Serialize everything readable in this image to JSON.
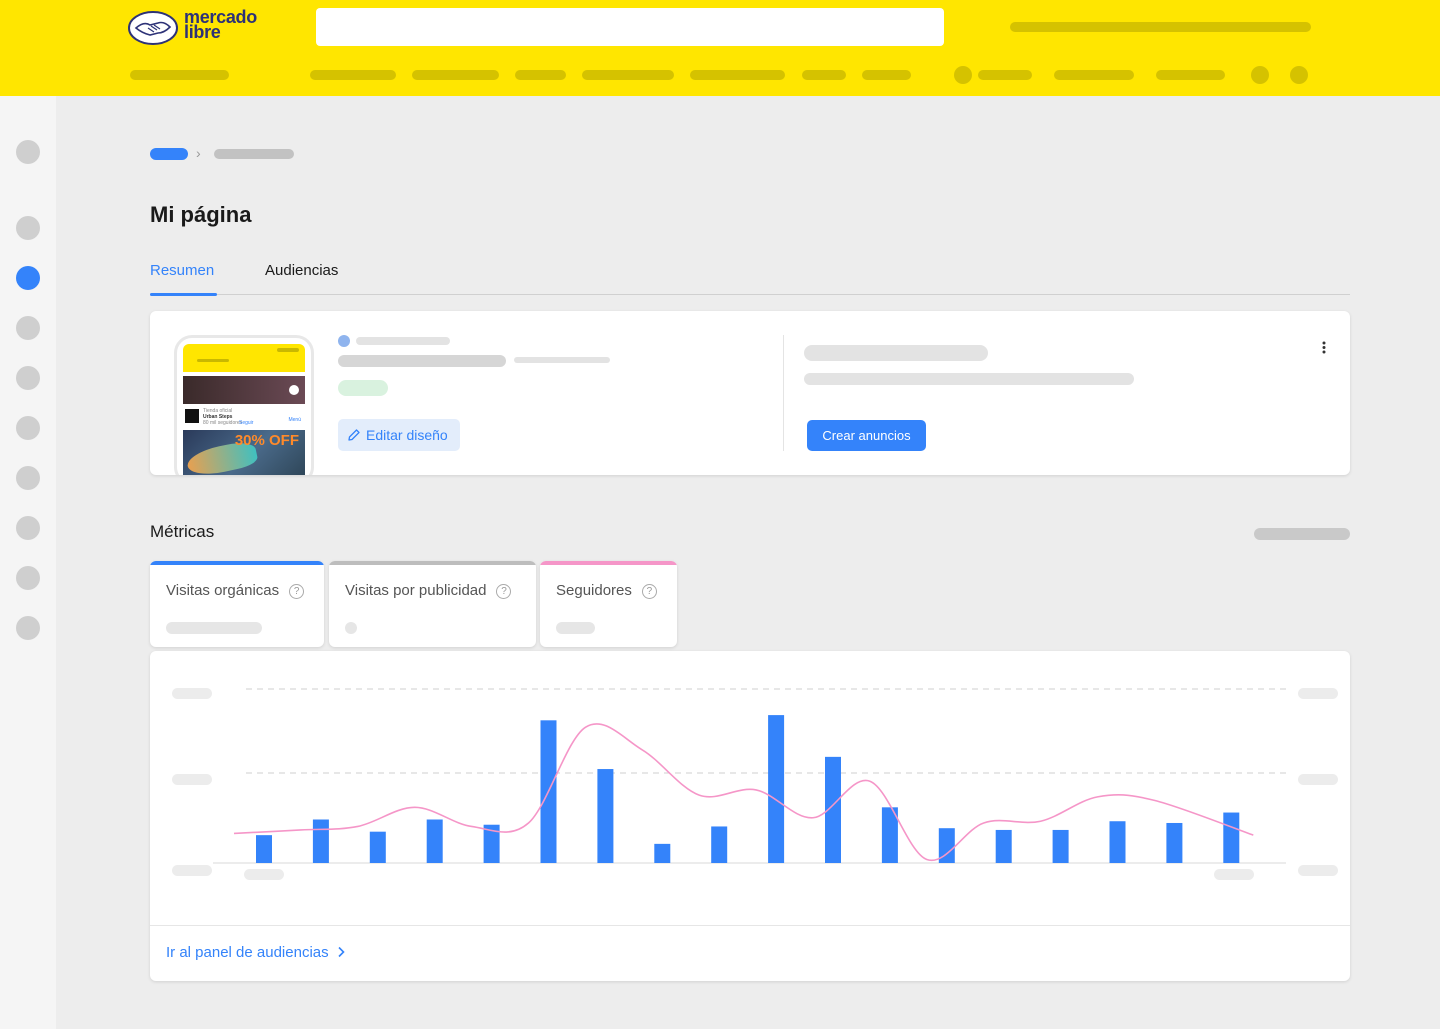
{
  "brand": {
    "name_line1": "mercado",
    "name_line2": "libre",
    "accent": "#ffe600",
    "primary": "#3483fa"
  },
  "page": {
    "title": "Mi página"
  },
  "tabs": [
    {
      "label": "Resumen",
      "active": true
    },
    {
      "label": "Audiencias",
      "active": false
    }
  ],
  "profile_card": {
    "edit_button": "Editar diseño",
    "create_ads_button": "Crear anuncios",
    "preview": {
      "store_label": "Tienda oficial",
      "store_name": "Urban Steps",
      "followers": "80 mil seguidores",
      "follow": "Seguir",
      "more": "Menú",
      "promo": "30% OFF"
    }
  },
  "metrics": {
    "title": "Métricas",
    "tabs": [
      {
        "label": "Visitas orgánicas",
        "color": "#3483fa"
      },
      {
        "label": "Visitas por publicidad",
        "color": "#bdbdbd"
      },
      {
        "label": "Seguidores",
        "color": "#f596c8"
      }
    ],
    "footer_link": "Ir al panel de audiencias"
  },
  "chart_data": {
    "type": "bar",
    "series": [
      {
        "name": "",
        "type": "bar",
        "color": "#3483fa",
        "values": [
          16,
          25,
          18,
          25,
          22,
          82,
          54,
          11,
          21,
          85,
          61,
          32,
          20,
          19,
          19,
          24,
          23,
          29
        ]
      },
      {
        "name": "",
        "type": "line",
        "color": "#f596c8",
        "values": [
          17,
          19,
          21,
          32,
          21,
          23,
          78,
          65,
          39,
          42,
          26,
          47,
          2,
          23,
          24,
          38,
          36,
          16
        ]
      }
    ],
    "ylim": [
      0,
      100
    ],
    "grid": true
  }
}
